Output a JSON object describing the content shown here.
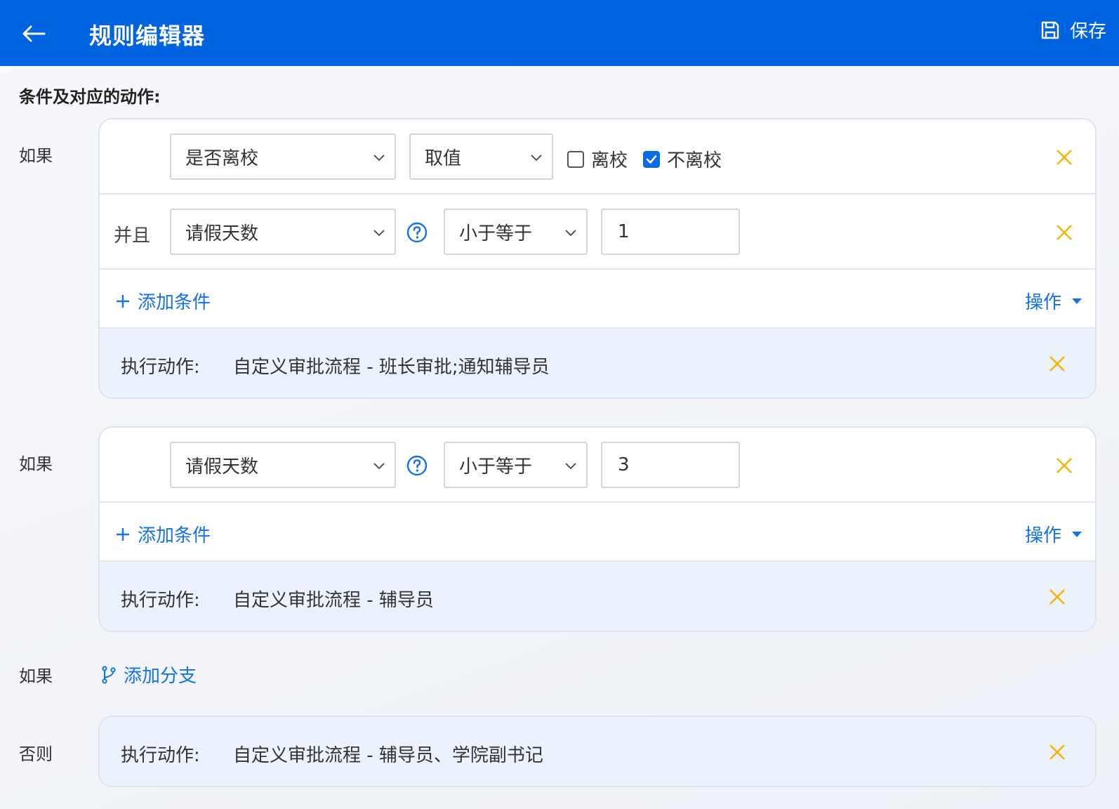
{
  "appbar": {
    "title": "规则编辑器",
    "save_label": "保存"
  },
  "section_title": "条件及对应的动作:",
  "labels": {
    "if": "如果",
    "else": "否则",
    "and": "并且"
  },
  "rule1": {
    "cond1": {
      "field": "是否离校",
      "operator": "取值",
      "option_a": "离校",
      "option_b": "不离校"
    },
    "cond2": {
      "field": "请假天数",
      "operator": "小于等于",
      "value": "1"
    },
    "add_condition": "添加条件",
    "ops": "操作",
    "action_label": "执行动作:",
    "action_text": "自定义审批流程 - 班长审批;通知辅导员"
  },
  "rule2": {
    "cond1": {
      "field": "请假天数",
      "operator": "小于等于",
      "value": "3"
    },
    "add_condition": "添加条件",
    "ops": "操作",
    "action_label": "执行动作:",
    "action_text": "自定义审批流程 - 辅导员"
  },
  "add_branch": "添加分支",
  "else_action": {
    "label": "执行动作:",
    "text": "自定义审批流程 - 辅导员、学院副书记"
  },
  "colors": {
    "primary": "#0063e0",
    "link": "#1572e6",
    "close": "#f5b400",
    "action_bg": "#ecf2fd"
  }
}
